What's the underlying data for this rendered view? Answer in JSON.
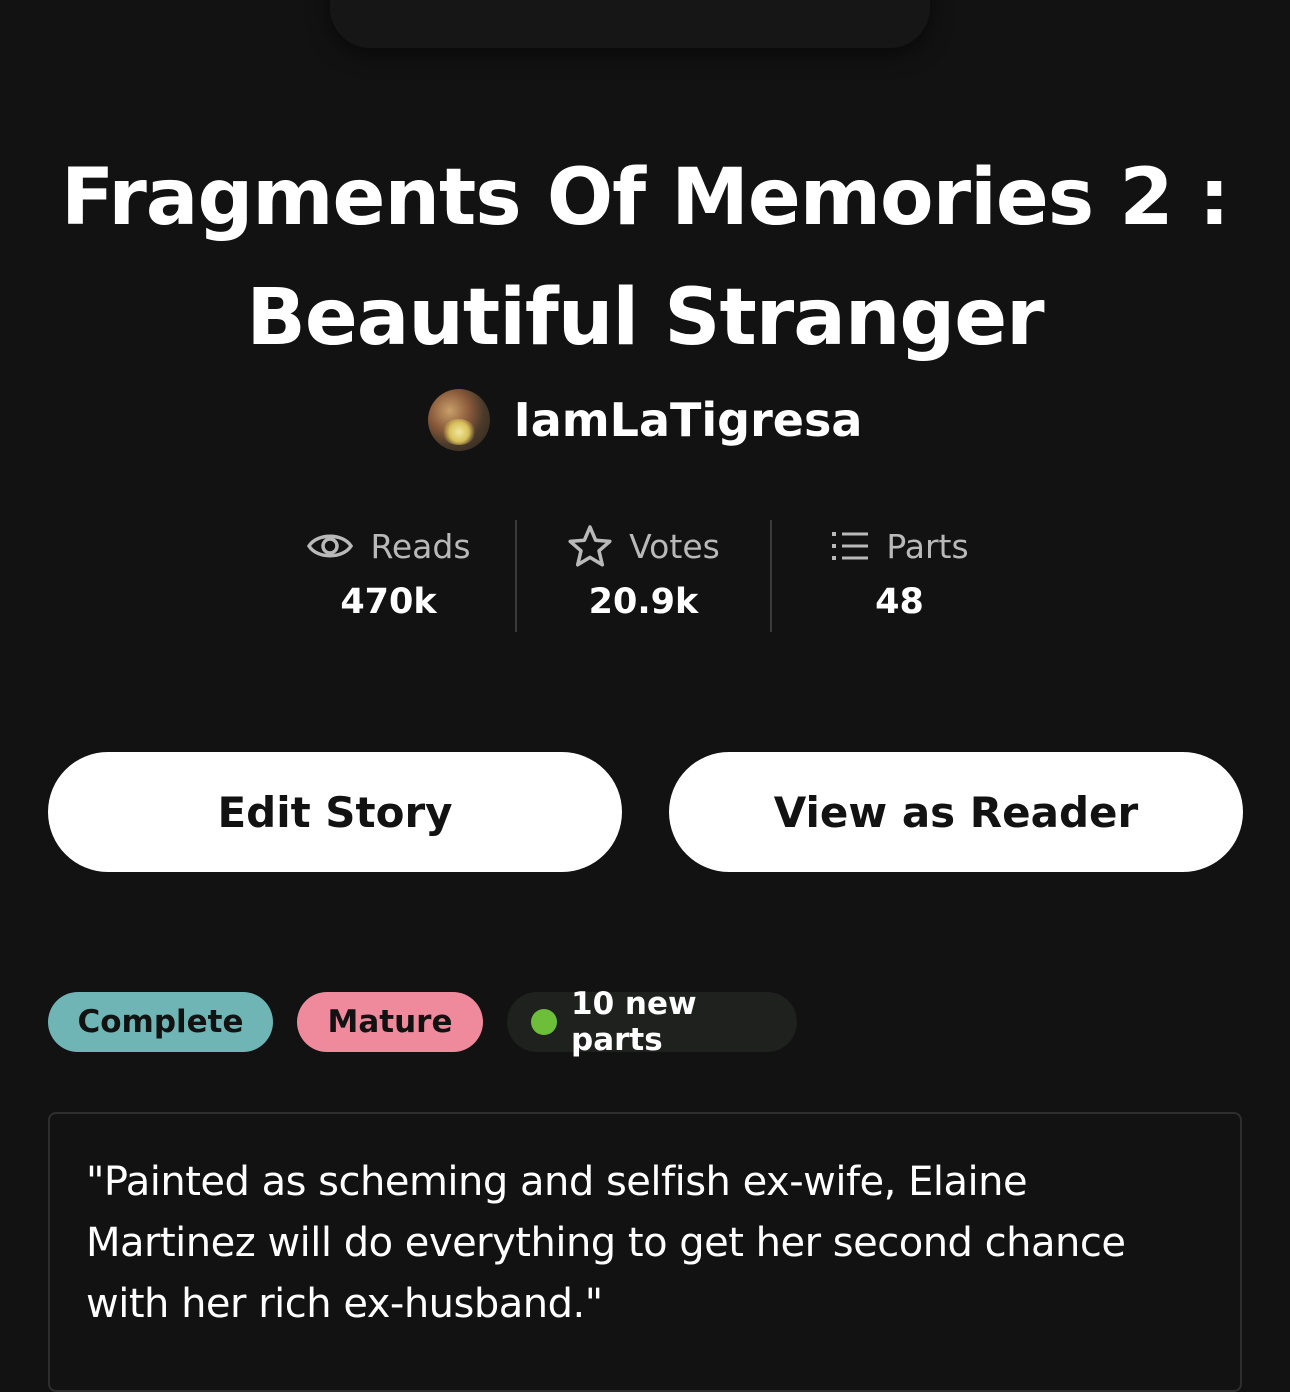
{
  "story": {
    "title": "Fragments Of Memories 2 : Beautiful Stranger",
    "author": "IamLaTigresa"
  },
  "stats": [
    {
      "icon": "eye-icon",
      "label": "Reads",
      "value": "470k"
    },
    {
      "icon": "star-icon",
      "label": "Votes",
      "value": "20.9k"
    },
    {
      "icon": "list-icon",
      "label": "Parts",
      "value": "48"
    }
  ],
  "actions": {
    "edit_label": "Edit Story",
    "reader_label": "View as Reader"
  },
  "tags": {
    "complete": "Complete",
    "mature": "Mature",
    "new_parts": "10 new parts"
  },
  "colors": {
    "background": "#121212",
    "complete_tag": "#6fb5b5",
    "mature_tag": "#ee8a9c",
    "new_dot": "#6dbf3a"
  },
  "description": "\"Painted as scheming and selfish ex-wife, Elaine Martinez will do everything to get her second chance with her rich ex-husband.\""
}
